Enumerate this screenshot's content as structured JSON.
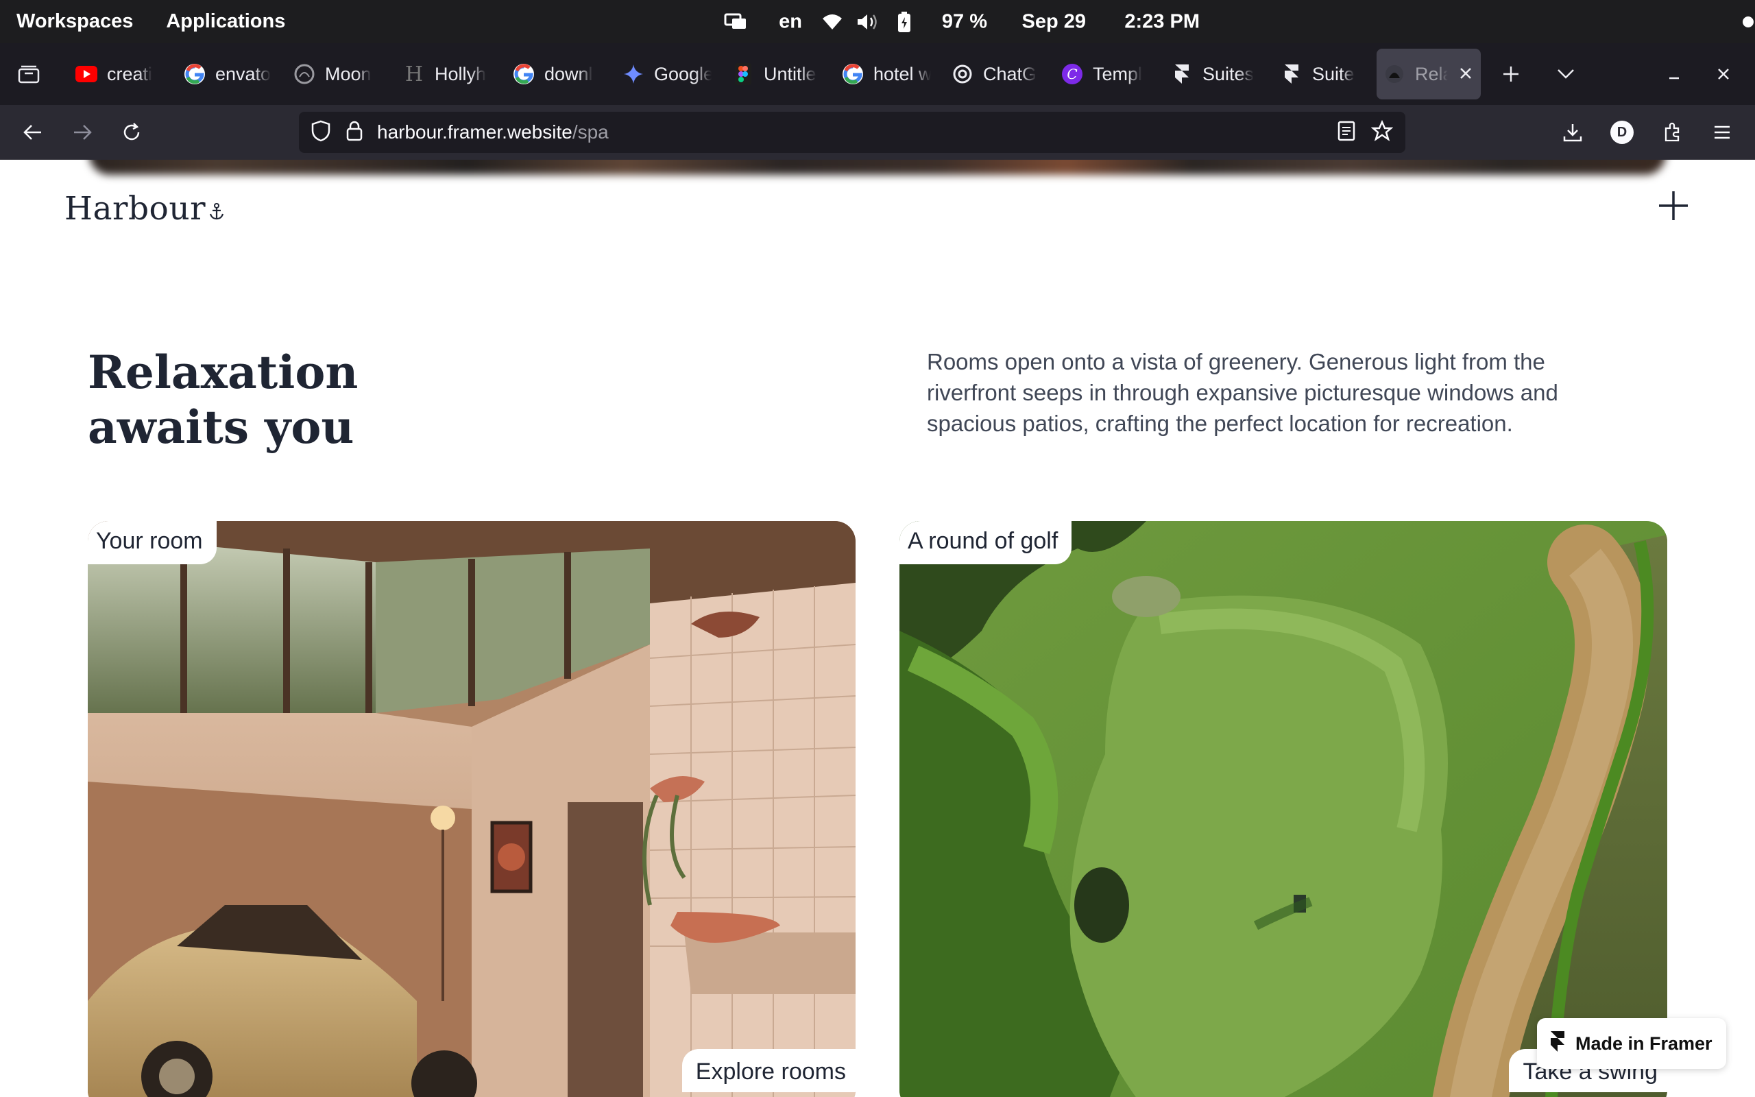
{
  "os_bar": {
    "workspaces": "Workspaces",
    "applications": "Applications",
    "language": "en",
    "battery": "97 %",
    "date": "Sep 29",
    "time": "2:23 PM"
  },
  "tabs": [
    {
      "label": "creati",
      "icon": "youtube-icon"
    },
    {
      "label": "envato",
      "icon": "google-icon"
    },
    {
      "label": "Moon",
      "icon": "moon-icon"
    },
    {
      "label": "Hollyh",
      "icon": "h-icon"
    },
    {
      "label": "downl",
      "icon": "google-icon"
    },
    {
      "label": "Google",
      "icon": "gemini-icon"
    },
    {
      "label": "Untitle",
      "icon": "figma-icon"
    },
    {
      "label": "hotel w",
      "icon": "google-icon"
    },
    {
      "label": "ChatG",
      "icon": "chatgpt-icon"
    },
    {
      "label": "Templ",
      "icon": "canva-icon"
    },
    {
      "label": "Suites",
      "icon": "framer-icon"
    },
    {
      "label": "Suite",
      "icon": "framer-icon"
    },
    {
      "label": "Rela",
      "icon": "harbour-icon",
      "active": true
    }
  ],
  "address_bar": {
    "host": "harbour.framer.website",
    "path": "/spa"
  },
  "profile_initial": "D",
  "page": {
    "logo": "Harbour",
    "headline_line1": "Relaxation",
    "headline_line2": "awaits you",
    "intro": "Rooms open onto a vista of greenery. Generous light from the riverfront seeps in through expansive picturesque windows and spacious patios, crafting the perfect location for recreation.",
    "cards": [
      {
        "tag": "Your room",
        "cta": "Explore rooms"
      },
      {
        "tag": "A round of golf",
        "cta": "Take a swing"
      }
    ],
    "badge": "Made in Framer"
  },
  "colors": {
    "os_bar": "#1d1d1f",
    "tab_strip": "#1c1b22",
    "nav_bar": "#2b2a33",
    "heading_text": "#1f2533",
    "body_text": "#404756"
  }
}
